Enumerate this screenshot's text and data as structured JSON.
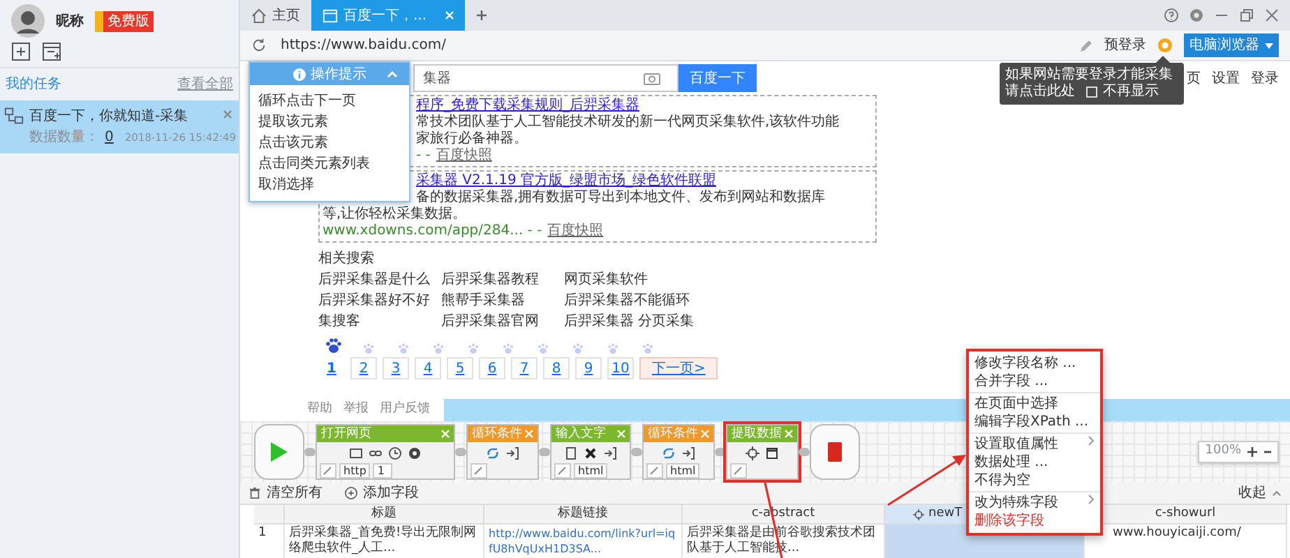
{
  "sidebar": {
    "user_name": "昵称",
    "badge": "免费版",
    "section_title": "我的任务",
    "view_all": "查看全部",
    "tasks": [
      {
        "title": "百度一下，你就知道-采集",
        "count_label": "数据数量：",
        "count": "0",
        "time": "2018-11-26 15:42:49",
        "selected": true
      }
    ]
  },
  "tabs": [
    {
      "kind": "home",
      "label": "主页",
      "selected": false
    },
    {
      "kind": "page",
      "label": "百度一下，...",
      "selected": true
    }
  ],
  "address_bar": {
    "url": "https://www.baidu.com/",
    "login_button": "预登录",
    "browser_mode": "电脑浏览器"
  },
  "login_tip": {
    "message": "如果网站需要登录才能采集",
    "link": "请点击此处",
    "checkbox_label": "不再显示",
    "checked": false
  },
  "page": {
    "search_value": "集器",
    "search_button": "百度一下",
    "top_links": [
      "页",
      "设置",
      "登录"
    ],
    "results": [
      {
        "title": "程序_免费下载采集规则_后羿采集器",
        "lines": [
          "常技术团队基于人工智能技术研发的新一代网页采集软件,该软件功能",
          "家旅行必备神器。"
        ],
        "url": "- -",
        "snapshot": "百度快照"
      },
      {
        "title": "采集器 V2.1.19 官方版_绿盟市场_绿色软件联盟",
        "lines": [
          "备的数据采集器,拥有数据可导出到本地文件、发布到网站和数据库",
          "等,让你轻松采集数据。"
        ],
        "url": "www.xdowns.com/app/284... - -",
        "snapshot": "百度快照"
      }
    ],
    "related_title": "相关搜索",
    "related": [
      "后羿采集器是什么",
      "后羿采集器教程",
      "网页采集软件",
      "后羿采集器好不好",
      "熊帮手采集器",
      "后羿采集器不能循环",
      "集搜客",
      "后羿采集器官网",
      "后羿采集器 分页采集"
    ],
    "pages": [
      {
        "label": "1",
        "selected": true
      },
      {
        "label": "2",
        "selected": false
      },
      {
        "label": "3",
        "selected": false
      },
      {
        "label": "4",
        "selected": false
      },
      {
        "label": "5",
        "selected": false
      },
      {
        "label": "6",
        "selected": false
      },
      {
        "label": "7",
        "selected": false
      },
      {
        "label": "8",
        "selected": false
      },
      {
        "label": "9",
        "selected": false
      },
      {
        "label": "10",
        "selected": false
      }
    ],
    "next_page": "下一页>"
  },
  "operation_popup": {
    "title": "操作提示",
    "items": [
      "循环点击下一页",
      "提取该元素",
      "点击该元素",
      "点击同类元素列表",
      "取消选择"
    ]
  },
  "footer_links": [
    "帮助",
    "举报",
    "用户反馈"
  ],
  "workflow": {
    "nodes": [
      {
        "kind": "start"
      },
      {
        "kind": "open",
        "label": "打开网页",
        "color": "#7cb82f",
        "slots": [
          "http",
          "1"
        ],
        "selected": false
      },
      {
        "kind": "loop",
        "label": "循环条件",
        "color": "#f0982a",
        "selected": false
      },
      {
        "kind": "input",
        "label": "输入文字",
        "color": "#7cb82f",
        "slots": [
          "html"
        ],
        "selected": false
      },
      {
        "kind": "loop",
        "label": "循环条件",
        "color": "#f0982a",
        "slots": [
          "html"
        ],
        "selected": false
      },
      {
        "kind": "extract",
        "label": "提取数据",
        "color": "#7cb82f",
        "selected": true
      },
      {
        "kind": "end"
      }
    ],
    "zoom": "100%"
  },
  "field_toolbar": {
    "clear": "清空所有",
    "add": "添加字段",
    "collapse": "收起"
  },
  "table": {
    "columns": [
      {
        "selected": false
      },
      {
        "label": "标题",
        "selected": false
      },
      {
        "label": "标题链接",
        "selected": false
      },
      {
        "label": "c-abstract",
        "selected": false
      },
      {
        "label": "newT",
        "selected": true
      },
      {
        "label": "c-showurl",
        "selected": false
      }
    ],
    "rows": [
      [
        "1",
        "后羿采集器_首免费!导出无限制网络爬虫软件_人工...",
        "http://www.baidu.com/link?url=iqfU8hVqUxH1D3SA...",
        "后羿采集器是由前谷歌搜索技术团队基于人工智能技...",
        "",
        "www.houyicaiji.com/"
      ]
    ]
  },
  "context_menu": [
    {
      "kind": "item",
      "label": "修改字段名称 ..."
    },
    {
      "kind": "item",
      "label": "合并字段 ..."
    },
    {
      "kind": "separator"
    },
    {
      "kind": "item",
      "label": "在页面中选择"
    },
    {
      "kind": "item",
      "label": "编辑字段XPath ..."
    },
    {
      "kind": "separator"
    },
    {
      "kind": "submenu",
      "label": "设置取值属性"
    },
    {
      "kind": "item",
      "label": "数据处理 ..."
    },
    {
      "kind": "item",
      "label": "不得为空"
    },
    {
      "kind": "separator"
    },
    {
      "kind": "submenu",
      "label": "改为特殊字段"
    },
    {
      "kind": "danger",
      "label": "删除该字段"
    }
  ]
}
